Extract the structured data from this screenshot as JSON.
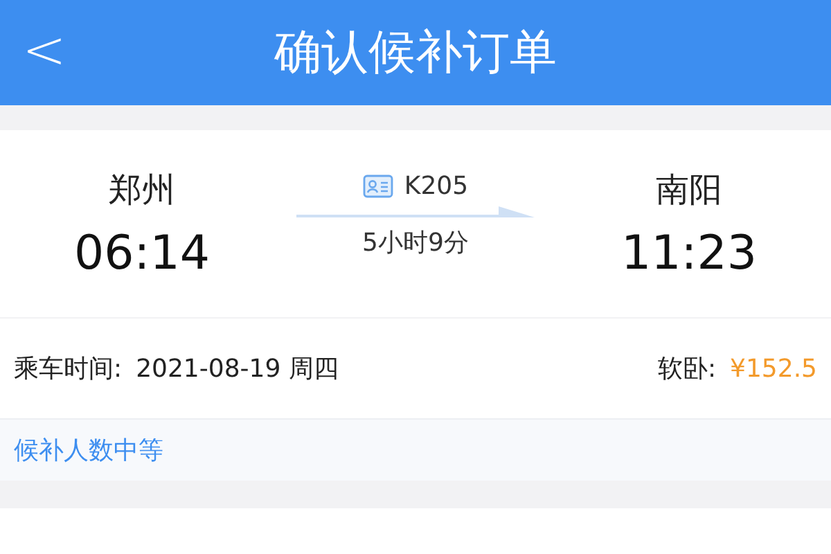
{
  "header": {
    "back": "<",
    "title": "确认候补订单"
  },
  "trip": {
    "from_station": "郑州",
    "depart_time": "06:14",
    "train_no": "K205",
    "duration": "5小时9分",
    "to_station": "南阳",
    "arrive_time": "11:23"
  },
  "ride": {
    "date_label": "乘车时间:",
    "date": "2021-08-19 周四",
    "seat_label": "软卧:",
    "price": "¥152.5"
  },
  "notice": "候补人数中等"
}
